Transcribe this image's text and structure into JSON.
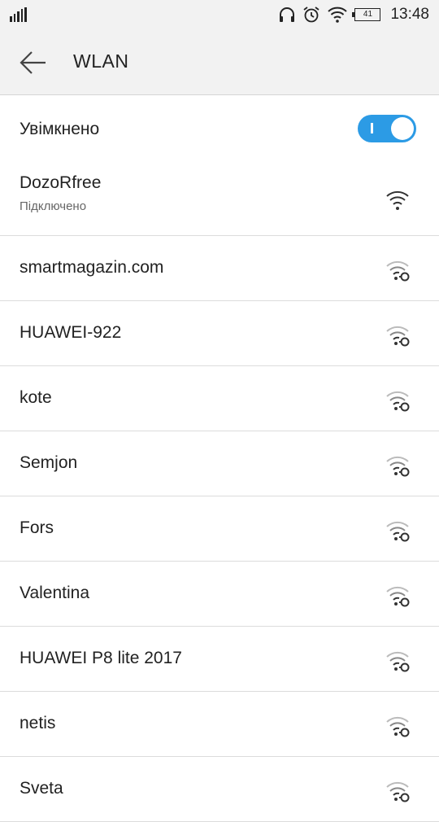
{
  "status_bar": {
    "time": "13:48",
    "battery_level": "41",
    "icons": [
      "signal-bars-icon",
      "headphones-icon",
      "alarm-clock-icon",
      "wifi-icon",
      "battery-icon"
    ]
  },
  "app_bar": {
    "title": "WLAN"
  },
  "toggle": {
    "label": "Увімкнено",
    "state": true,
    "accent_color": "#2c9be5"
  },
  "connected_network": {
    "ssid": "DozoRfree",
    "status": "Підключено"
  },
  "networks": [
    {
      "ssid": "smartmagazin.com",
      "secured": true
    },
    {
      "ssid": "HUAWEI-922",
      "secured": true
    },
    {
      "ssid": "kote",
      "secured": true
    },
    {
      "ssid": "Semjon",
      "secured": true
    },
    {
      "ssid": "Fors",
      "secured": true
    },
    {
      "ssid": "Valentina",
      "secured": true
    },
    {
      "ssid": "HUAWEI P8 lite 2017",
      "secured": true
    },
    {
      "ssid": "netis",
      "secured": true
    },
    {
      "ssid": "Sveta",
      "secured": true
    }
  ]
}
